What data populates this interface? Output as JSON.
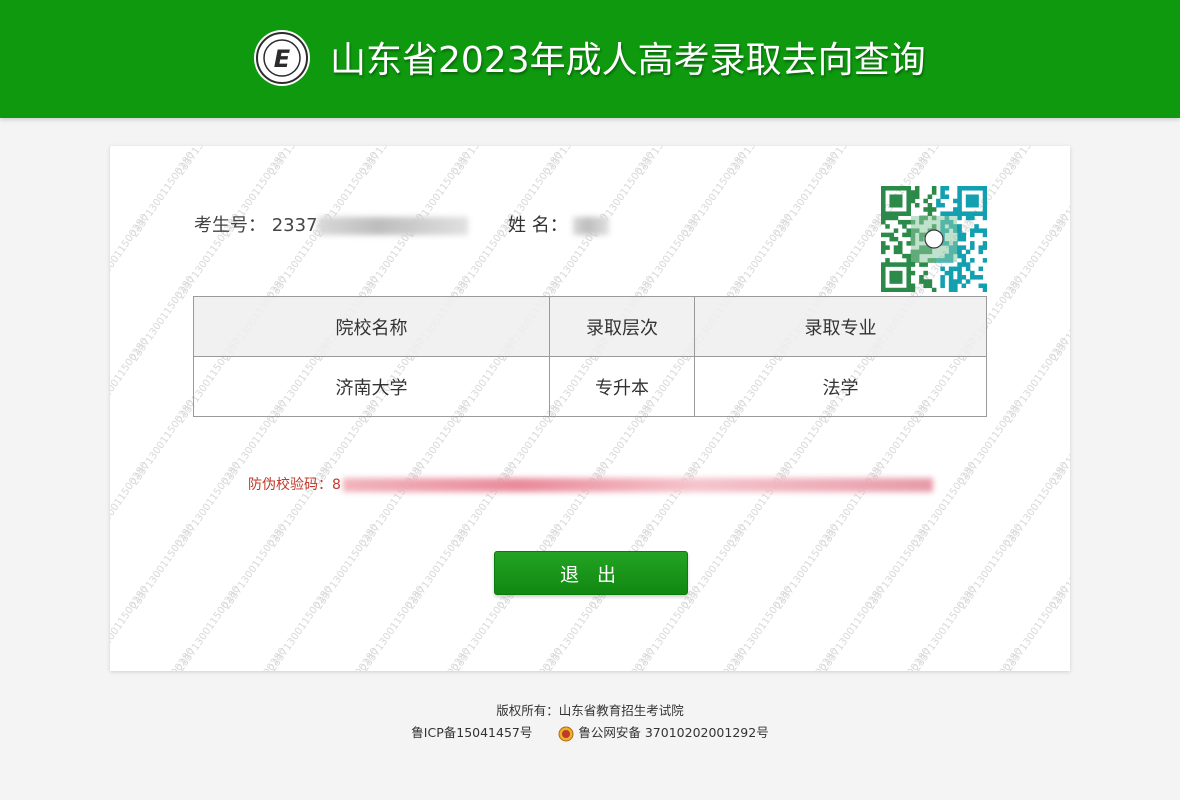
{
  "header": {
    "title": "山东省2023年成人高考录取去向查询",
    "logo_letter": "E",
    "bg_color": "#0e990e"
  },
  "watermark": {
    "text": "2337130011500280"
  },
  "candidate": {
    "id_label": "考生号：",
    "id_visible": "2337",
    "name_label": "姓 名："
  },
  "table": {
    "headers": [
      "院校名称",
      "录取层次",
      "录取专业"
    ],
    "rows": [
      [
        "济南大学",
        "专升本",
        "法学"
      ]
    ]
  },
  "verify": {
    "label": "防伪校验码：",
    "visible_prefix": "8"
  },
  "exit_button": {
    "label": "退 出"
  },
  "footer": {
    "copyright": "版权所有：山东省教育招生考试院",
    "icp": "鲁ICP备15041457号",
    "police": "鲁公网安备 37010202001292号"
  }
}
